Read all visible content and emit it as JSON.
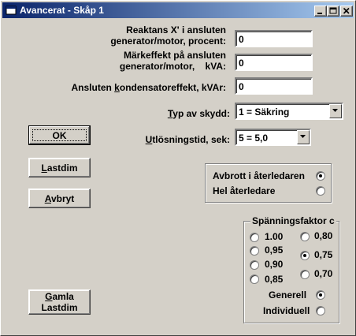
{
  "window": {
    "title": "Avancerat - Skåp 1"
  },
  "fields": {
    "reaktans": {
      "label_line1": "Reaktans X' i ansluten",
      "label_line2": "generator/motor, procent:",
      "value": "0"
    },
    "markeffekt": {
      "label_line1": "Märkeffekt på ansluten",
      "label_line2": "generator/motor,    kVA:",
      "value": "0"
    },
    "kondensator": {
      "label_pre": "Ansluten ",
      "label_ul": "k",
      "label_post": "ondensatoreffekt, kVAr:",
      "value": "0"
    },
    "typ_av_skydd": {
      "label_ul": "T",
      "label_post": "yp av skydd:",
      "value": "1 = Säkring"
    },
    "utlosningstid": {
      "label_ul": "U",
      "label_post": "tlösningstid, sek:",
      "value": "5 = 5,0"
    }
  },
  "buttons": {
    "ok": "OK",
    "lastdim": {
      "ul": "L",
      "rest": "astdim"
    },
    "avbryt": {
      "ul": "A",
      "rest": "vbryt"
    },
    "gamla_lastdim": {
      "line1_ul": "G",
      "line1_rest": "amla",
      "line2": "Lastdim"
    }
  },
  "avbrott_group": {
    "options": [
      {
        "label": "Avbrott i återledaren",
        "checked": true
      },
      {
        "label": "Hel återledare",
        "checked": false
      }
    ]
  },
  "spanningsfaktor": {
    "caption": "Spänningsfaktor c",
    "left_options": [
      "1.00",
      "0,95",
      "0,90",
      "0,85"
    ],
    "right_options": [
      "0,80",
      "0,75",
      "0,70"
    ],
    "selected": "0,75",
    "mode_options": [
      {
        "label": "Generell",
        "checked": true
      },
      {
        "label": "Individuell",
        "checked": false
      }
    ]
  }
}
